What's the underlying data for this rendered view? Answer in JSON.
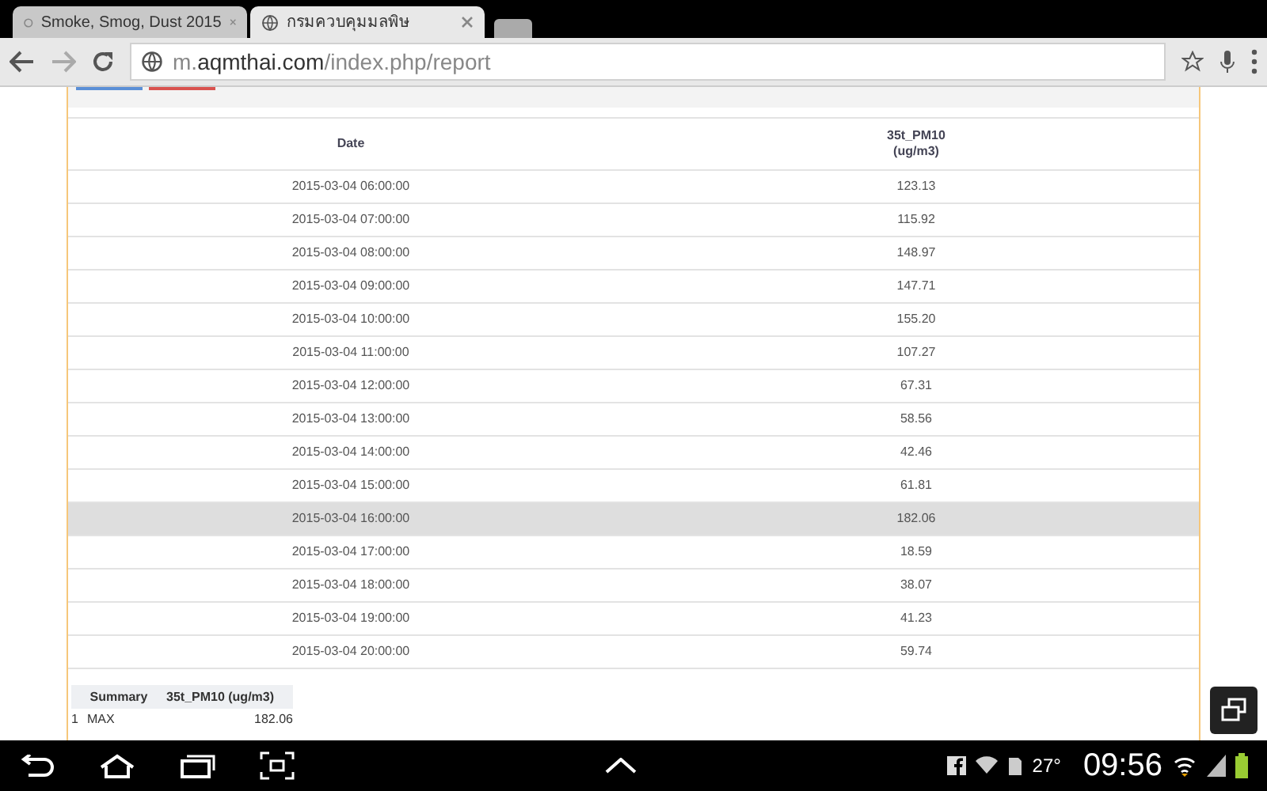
{
  "browser_tabs": [
    {
      "title": "Smoke, Smog, Dust 2015",
      "selected": false,
      "loading": true
    },
    {
      "title": "กรมควบคุมมลพิษ",
      "selected": true,
      "loading": false
    }
  ],
  "address_bar": {
    "prefix": "m.",
    "domain": "aqmthai.com",
    "path": "/index.php/report"
  },
  "table": {
    "columns": [
      "Date",
      "35t_PM10\n(ug/m3)"
    ],
    "rows": [
      {
        "date": "2015-03-04 06:00:00",
        "value": "123.13",
        "highlighted": false
      },
      {
        "date": "2015-03-04 07:00:00",
        "value": "115.92",
        "highlighted": false
      },
      {
        "date": "2015-03-04 08:00:00",
        "value": "148.97",
        "highlighted": false
      },
      {
        "date": "2015-03-04 09:00:00",
        "value": "147.71",
        "highlighted": false
      },
      {
        "date": "2015-03-04 10:00:00",
        "value": "155.20",
        "highlighted": false
      },
      {
        "date": "2015-03-04 11:00:00",
        "value": "107.27",
        "highlighted": false
      },
      {
        "date": "2015-03-04 12:00:00",
        "value": "67.31",
        "highlighted": false
      },
      {
        "date": "2015-03-04 13:00:00",
        "value": "58.56",
        "highlighted": false
      },
      {
        "date": "2015-03-04 14:00:00",
        "value": "42.46",
        "highlighted": false
      },
      {
        "date": "2015-03-04 15:00:00",
        "value": "61.81",
        "highlighted": false
      },
      {
        "date": "2015-03-04 16:00:00",
        "value": "182.06",
        "highlighted": true
      },
      {
        "date": "2015-03-04 17:00:00",
        "value": "18.59",
        "highlighted": false
      },
      {
        "date": "2015-03-04 18:00:00",
        "value": "38.07",
        "highlighted": false
      },
      {
        "date": "2015-03-04 19:00:00",
        "value": "41.23",
        "highlighted": false
      },
      {
        "date": "2015-03-04 20:00:00",
        "value": "59.74",
        "highlighted": false
      }
    ]
  },
  "summary": {
    "columns": [
      "Summary",
      "35t_PM10 (ug/m3)"
    ],
    "rows": [
      {
        "index": "1",
        "label": "MAX",
        "value": "182.06"
      }
    ]
  },
  "status_bar": {
    "temperature": "27°",
    "time": "09:56"
  }
}
